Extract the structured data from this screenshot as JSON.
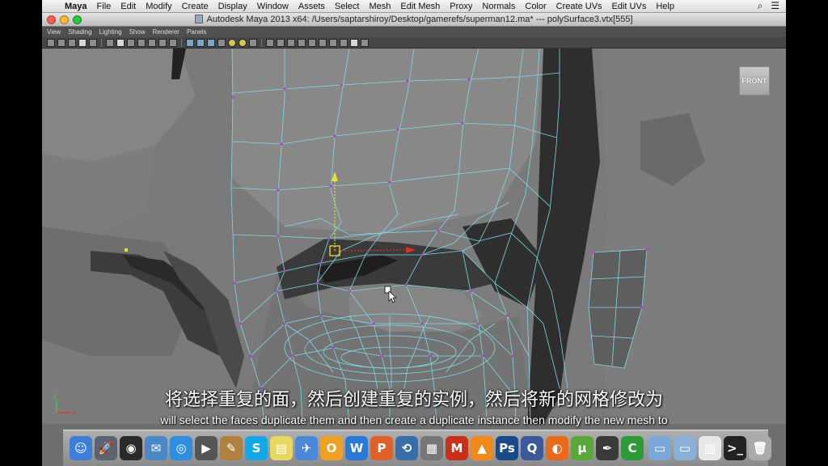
{
  "menubar": {
    "apple_glyph": "",
    "items": [
      "Maya",
      "File",
      "Edit",
      "Modify",
      "Create",
      "Display",
      "Window",
      "Assets",
      "Select",
      "Mesh",
      "Edit Mesh",
      "Proxy",
      "Normals",
      "Color",
      "Create UVs",
      "Edit UVs",
      "Help"
    ],
    "right_icons": [
      "search-icon",
      "list-icon"
    ]
  },
  "window": {
    "title": "Autodesk Maya 2013 x64:  /Users/saptarshiroy/Desktop/gamerefs/superman12.ma*   ---   polySurface3.vtx[555]",
    "traffic_lights": [
      "#ff5f57",
      "#febc2e",
      "#28c840"
    ]
  },
  "panel_menu": [
    "View",
    "Shading",
    "Lighting",
    "Show",
    "Renderer",
    "Panels"
  ],
  "viewport": {
    "view_cube_label": "FRONT",
    "axis": {
      "x": "x",
      "y": "y"
    },
    "wire_color": "#7fd9e8",
    "vertex_color": "#b040c0",
    "manip_x_color": "#e0302a",
    "manip_y_color": "#e8e02a"
  },
  "subtitles": {
    "chinese": "将选择重复的面，然后创建重复的实例，然后将新的网格修改为",
    "english": "will select the faces duplicate them and then create a duplicate instance then modify the new mesh to"
  },
  "dock": {
    "apps": [
      {
        "name": "finder-icon",
        "glyph": "☺",
        "color": "#3c7ed8"
      },
      {
        "name": "launchpad-icon",
        "glyph": "🚀",
        "color": "#5a6470"
      },
      {
        "name": "dashboard-icon",
        "glyph": "◉",
        "color": "#2a2a2a"
      },
      {
        "name": "preview-icon",
        "glyph": "✉",
        "color": "#4a88c8"
      },
      {
        "name": "safari-icon",
        "glyph": "◎",
        "color": "#2f8ee0"
      },
      {
        "name": "facetime-icon",
        "glyph": "▶",
        "color": "#555"
      },
      {
        "name": "contacts-icon",
        "glyph": "✎",
        "color": "#b08040"
      },
      {
        "name": "skype-icon",
        "glyph": "S",
        "color": "#12a8e8"
      },
      {
        "name": "stickies-icon",
        "glyph": "▤",
        "color": "#e8d860"
      },
      {
        "name": "mail-icon",
        "glyph": "✈",
        "color": "#4a88d8"
      },
      {
        "name": "openoffice-icon",
        "glyph": "O",
        "color": "#f0a020"
      },
      {
        "name": "word-icon",
        "glyph": "W",
        "color": "#2a78d8"
      },
      {
        "name": "powerpoint-icon",
        "glyph": "P",
        "color": "#e0602a"
      },
      {
        "name": "time-machine-icon",
        "glyph": "⟲",
        "color": "#3a6ea8"
      },
      {
        "name": "photo-icon",
        "glyph": "▦",
        "color": "#777"
      },
      {
        "name": "maya-icon",
        "glyph": "M",
        "color": "#c8301a"
      },
      {
        "name": "vlc-icon",
        "glyph": "▲",
        "color": "#f08a1a"
      },
      {
        "name": "photoshop-icon",
        "glyph": "Ps",
        "color": "#1a4a8a"
      },
      {
        "name": "quicktime-icon",
        "glyph": "Q",
        "color": "#3a5a9a"
      },
      {
        "name": "firefox-icon",
        "glyph": "◐",
        "color": "#e86a1a"
      },
      {
        "name": "utorrent-icon",
        "glyph": "µ",
        "color": "#5aa83a"
      },
      {
        "name": "inkscape-icon",
        "glyph": "✒",
        "color": "#3a3a3a"
      },
      {
        "name": "camtasia-icon",
        "glyph": "C",
        "color": "#2e9a3a"
      }
    ],
    "stacks": [
      {
        "name": "applications-folder-icon",
        "glyph": "▭",
        "color": "#7aa8d8"
      },
      {
        "name": "documents-folder-icon",
        "glyph": "▭",
        "color": "#8ab0d8"
      },
      {
        "name": "document-stack-icon",
        "glyph": "▥",
        "color": "#e8e8e8"
      },
      {
        "name": "terminal-icon",
        "glyph": ">_",
        "color": "#222"
      },
      {
        "name": "trash-icon",
        "glyph": "🗑",
        "color": "#aaa"
      }
    ]
  }
}
